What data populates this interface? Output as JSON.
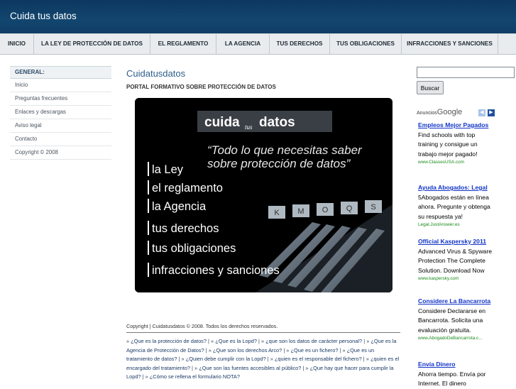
{
  "site": {
    "title": "Cuida tus datos"
  },
  "nav": {
    "items": [
      {
        "label": "INICIO"
      },
      {
        "label": "LA LEY DE PROTECCIÓN DE DATOS"
      },
      {
        "label": "EL REGLAMENTO"
      },
      {
        "label": "LA AGENCIA"
      },
      {
        "label": "TUS DERECHOS"
      },
      {
        "label": "TUS OBLIGACIONES"
      },
      {
        "label": "INFRACCIONES Y SANCIONES"
      }
    ]
  },
  "sidebar": {
    "heading": "GENERAL:",
    "links": [
      "Inicio",
      "Preguntas frecuentes",
      "Enlaces y descargas",
      "Aviso legal",
      "Contacto",
      "Copyright © 2008"
    ]
  },
  "main": {
    "title": "Cuidatusdatos",
    "subtitle": "PORTAL FORMATIVO SOBRE PROTECCIÓN DE DATOS",
    "banner": {
      "logo_cuida": "cuida",
      "logo_tus": "tus",
      "logo_datos": "datos",
      "quote_line1": "“Todo lo que necesitas saber",
      "quote_line2": "sobre protección de datos”",
      "items": [
        "la Ley",
        "el reglamento",
        "la Agencia",
        "tus derechos",
        "tus obligaciones",
        "infracciones y sanciones"
      ],
      "tab_letters": [
        "K",
        "M",
        "O",
        "Q",
        "S"
      ]
    },
    "copyright": "Copyright | Cuidatusdatos © 2008. Todos los derechos reservados.",
    "faq_links": [
      "¿Que es la protección de datos?",
      "¿Que es la Lopd?",
      "¿que son los datos de carácter personal?",
      "¿Que es la Agencia de Protección de Datos?",
      "¿Que son los derechos Arco?",
      "¿Que es un fichero?",
      "¿Que es un tratamiento de datos?",
      "¿Quien debe cumplir con la Lopd?",
      "¿quien es el responsable del fichero?",
      "¿quien es el encargado del tratamiento?",
      "¿Que son las fuentes accesibles al público?",
      "¿Que hay que hacer para cumplir la Lopd?",
      "¿Cómo se rellena el formulario NOTA?"
    ]
  },
  "search": {
    "value": "",
    "button_label": "Buscar"
  },
  "ads": {
    "label": "Anuncios",
    "brand": "Google",
    "prev_icon": "◀",
    "next_icon": "▶",
    "items": [
      {
        "title": "Empleos Mejor Pagados",
        "body": "Find schools with top training y consigue un trabajo mejor pagado!",
        "url": "www.ClassesUSA.com"
      },
      {
        "title": "Ayuda Abogados: Legal",
        "body": "5Abogados están en línea ahora. Pregunte y obtenga su respuesta ya!",
        "url": "Legal.JustAnswer.es"
      },
      {
        "title": "Official Kaspersky 2011",
        "body": "Advanced Virus & Spyware Protection The Complete Solution. Download Now",
        "url": "www.kaspersky.com"
      },
      {
        "title": "Considere La Bancarrota",
        "body": "Considere Declararse en Bancarrota. Solicita una evaluación gratuita.",
        "url": "www.AbogadoDeBancarrota.c..."
      },
      {
        "title": "Envía Dinero",
        "body": "Ahorra tiempo. Envía por Internet. El dinero",
        "url": ""
      }
    ]
  },
  "colors": {
    "header_bg": "#12466f",
    "link": "#1235c8",
    "ad_url": "#1a8a1a",
    "title_blue": "#2d5e8a"
  }
}
